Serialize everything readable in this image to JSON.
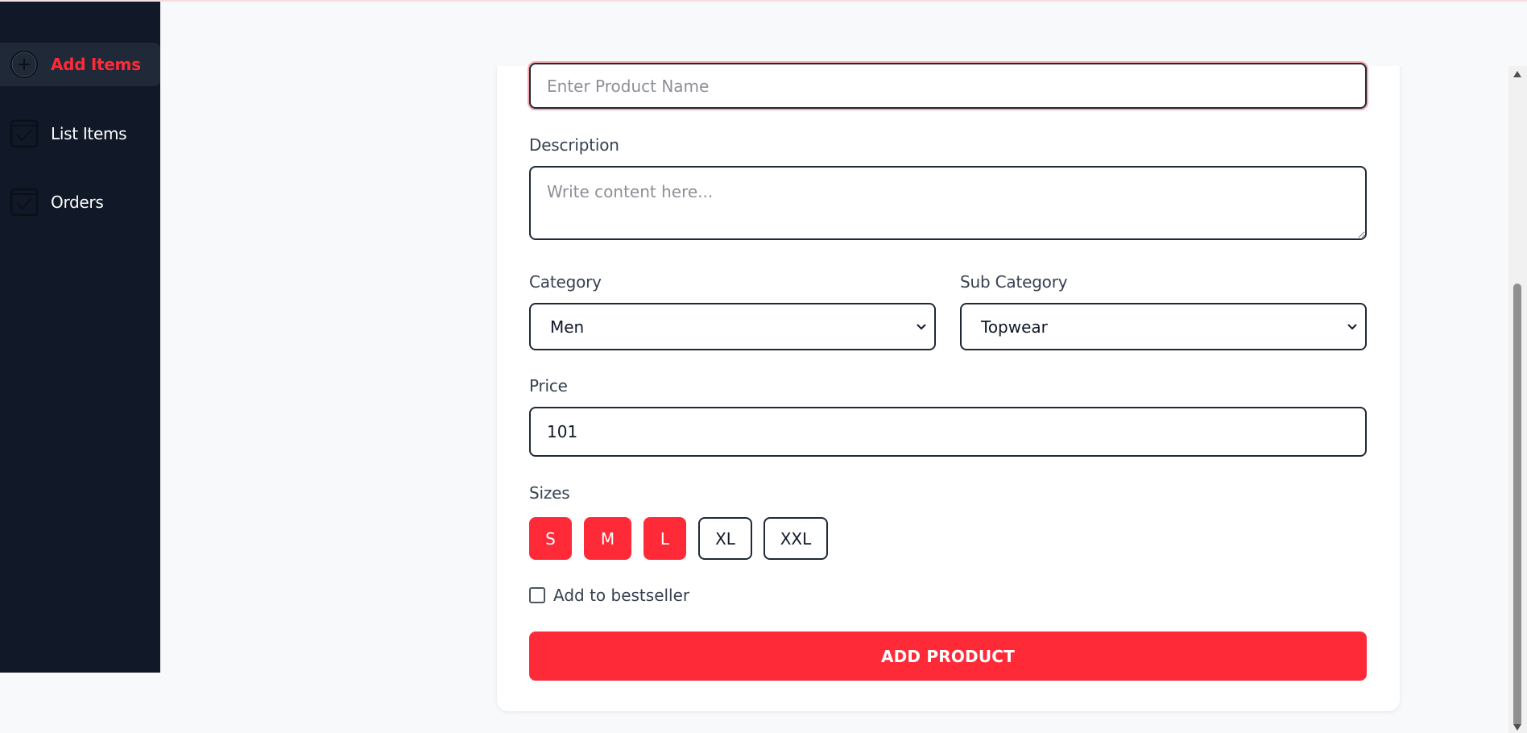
{
  "sidebar": {
    "items": [
      {
        "label": "Add Items",
        "icon": "add-circle-icon",
        "active": true
      },
      {
        "label": "List Items",
        "icon": "checklist-icon",
        "active": false
      },
      {
        "label": "Orders",
        "icon": "checklist-icon",
        "active": false
      }
    ]
  },
  "form": {
    "name_placeholder": "Enter Product Name",
    "description_label": "Description",
    "description_placeholder": "Write content here...",
    "category_label": "Category",
    "category_value": "Men",
    "subcategory_label": "Sub Category",
    "subcategory_value": "Topwear",
    "price_label": "Price",
    "price_value": "101",
    "sizes_label": "Sizes",
    "sizes": [
      {
        "label": "S",
        "selected": true
      },
      {
        "label": "M",
        "selected": true
      },
      {
        "label": "L",
        "selected": true
      },
      {
        "label": "XL",
        "selected": false
      },
      {
        "label": "XXL",
        "selected": false
      }
    ],
    "bestseller_label": "Add to bestseller",
    "bestseller_checked": false,
    "submit_label": "ADD PRODUCT"
  },
  "colors": {
    "accent": "#ff2a38",
    "sidebar_bg": "#111827",
    "page_bg": "#f8f9fb"
  }
}
